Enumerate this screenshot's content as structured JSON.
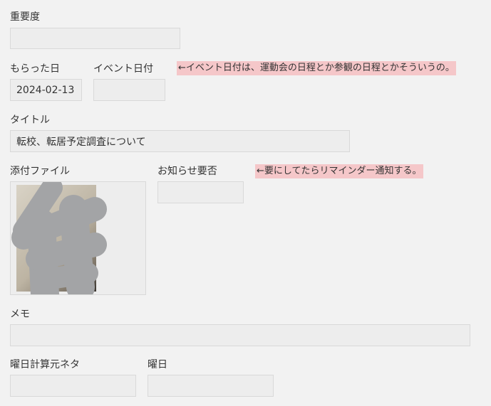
{
  "importance": {
    "label": "重要度",
    "value": ""
  },
  "received_date": {
    "label": "もらった日",
    "value": "2024-02-13"
  },
  "event_date": {
    "label": "イベント日付",
    "value": "",
    "note": "←イベント日付は、運動会の日程とか参観の日程とかそういうの。"
  },
  "title": {
    "label": "タイトル",
    "value": "転校、転居予定調査について"
  },
  "attachment": {
    "label": "添付ファイル",
    "image_icon": "redacted-photo-thumbnail"
  },
  "notice_required": {
    "label": "お知らせ要否",
    "value": "",
    "note": "←要にしてたらリマインダー通知する。"
  },
  "memo": {
    "label": "メモ",
    "value": ""
  },
  "weekday_source": {
    "label": "曜日計算元ネタ",
    "value": ""
  },
  "weekday": {
    "label": "曜日",
    "value": ""
  },
  "colors": {
    "background": "#f2f2f2",
    "field_background": "#ededed",
    "field_border": "#d9d9d9",
    "note_highlight": "#f5c7c9",
    "redaction_gray": "#a3a4a6"
  }
}
